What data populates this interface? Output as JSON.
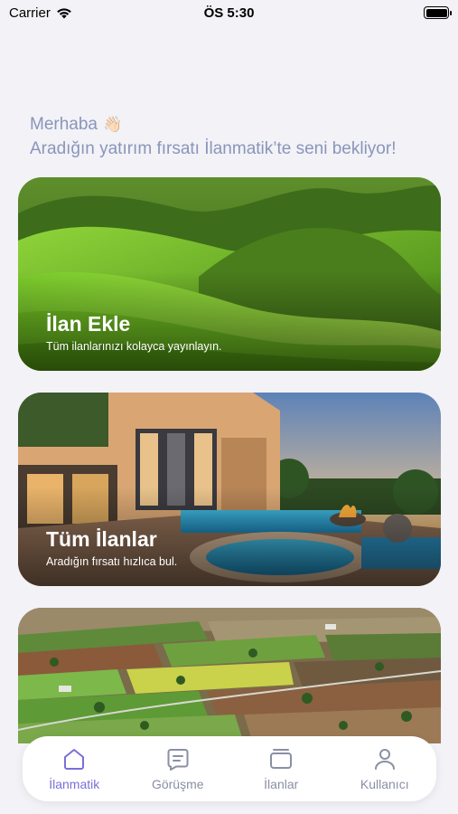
{
  "status_bar": {
    "carrier": "Carrier",
    "time": "ÖS 5:30",
    "battery_level": 1.0
  },
  "greeting": {
    "hello": "Merhaba",
    "wave_icon": "👋🏻",
    "message": "Aradığın yatırım fırsatı İlanmatik’te seni bekliyor!"
  },
  "cards": [
    {
      "title": "İlan Ekle",
      "subtitle": "Tüm ilanlarınızı kolayca yayınlayın.",
      "image": "green-hills"
    },
    {
      "title": "Tüm İlanlar",
      "subtitle": "Aradığın fırsatı hızlıca bul.",
      "image": "villa-pool-sunset"
    },
    {
      "title": "",
      "subtitle": "",
      "image": "farmland-aerial"
    }
  ],
  "tabbar": {
    "active_color": "#7a6fd8",
    "inactive_color": "#8a8fa3",
    "items": [
      {
        "label": "İlanmatik",
        "icon": "home-icon",
        "active": true
      },
      {
        "label": "Görüşme",
        "icon": "chat-icon",
        "active": false
      },
      {
        "label": "İlanlar",
        "icon": "listings-icon",
        "active": false
      },
      {
        "label": "Kullanıcı",
        "icon": "user-icon",
        "active": false
      }
    ]
  }
}
